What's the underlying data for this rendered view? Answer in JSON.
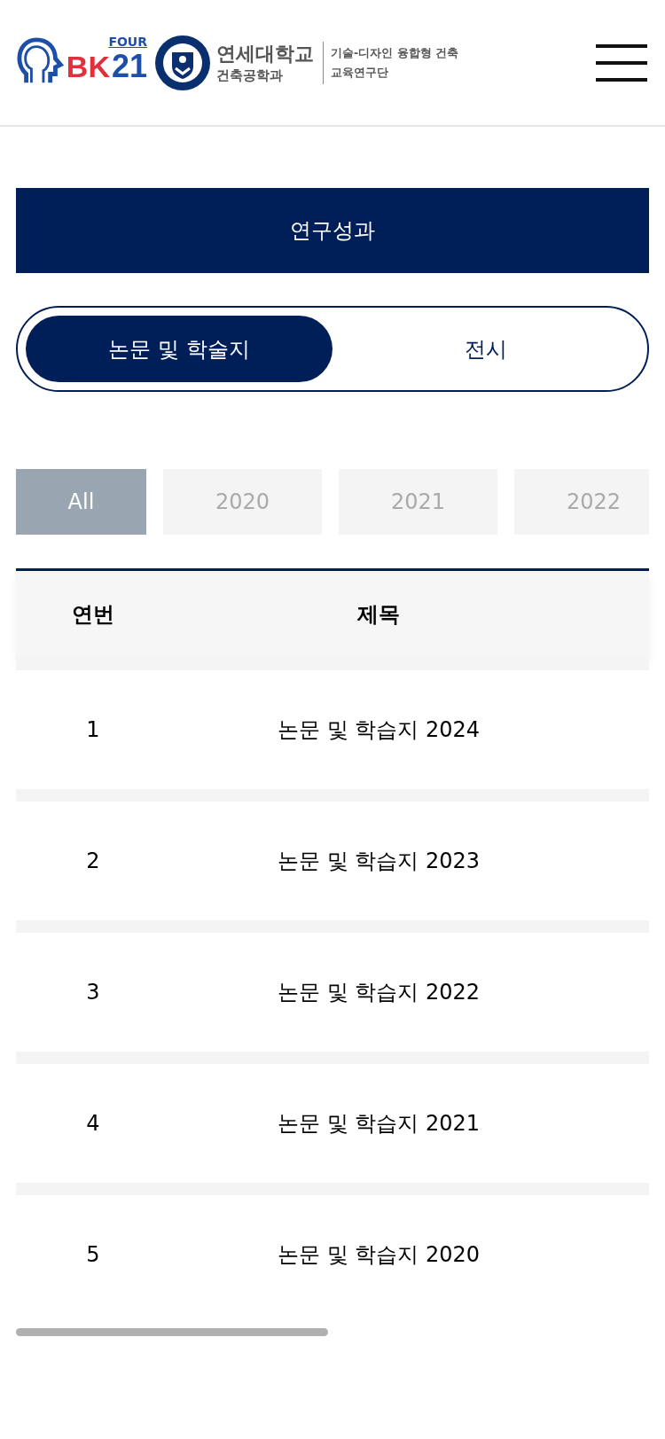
{
  "header": {
    "bk_logo": {
      "four": "FOUR",
      "bk": "BK",
      "num": "21"
    },
    "university": "연세대학교",
    "department": "건축공학과",
    "group_line1": "기술-디자인 융합형 건축",
    "group_line2": "교육연구단"
  },
  "page_title": "연구성과",
  "tabs": [
    {
      "label": "논문 및 학술지",
      "selected": true
    },
    {
      "label": "전시",
      "selected": false
    }
  ],
  "years": [
    {
      "label": "All",
      "selected": true
    },
    {
      "label": "2020",
      "selected": false
    },
    {
      "label": "2021",
      "selected": false
    },
    {
      "label": "2022",
      "selected": false
    }
  ],
  "table": {
    "columns": [
      "연번",
      "제목"
    ],
    "rows": [
      {
        "no": "1",
        "title": "논문 및 학습지 2024"
      },
      {
        "no": "2",
        "title": "논문 및 학습지 2023"
      },
      {
        "no": "3",
        "title": "논문 및 학습지 2022"
      },
      {
        "no": "4",
        "title": "논문 및 학습지 2021"
      },
      {
        "no": "5",
        "title": "논문 및 학습지 2020"
      }
    ]
  }
}
